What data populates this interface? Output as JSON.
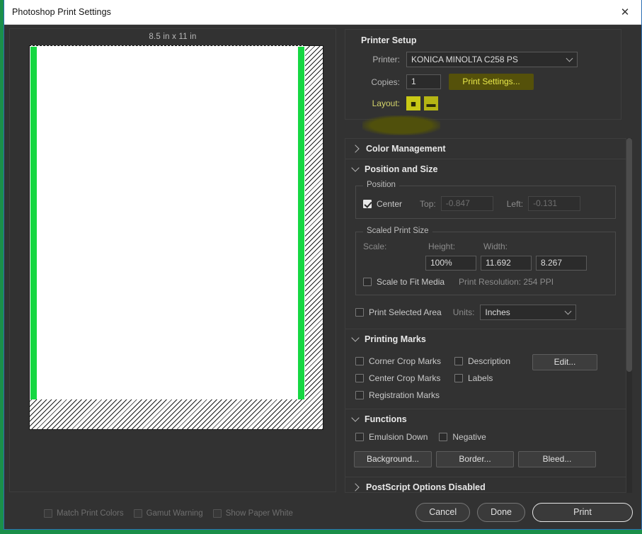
{
  "window": {
    "title": "Photoshop Print Settings",
    "close_icon": "close-icon"
  },
  "preview": {
    "page_dimensions": "8.5 in x 11 in",
    "accent_green": "#16d742",
    "proof_options": [
      {
        "label": "Match Print Colors",
        "checked": false,
        "disabled": true
      },
      {
        "label": "Gamut Warning",
        "checked": false,
        "disabled": true
      },
      {
        "label": "Show Paper White",
        "checked": false,
        "disabled": true
      }
    ]
  },
  "printer_setup": {
    "title": "Printer Setup",
    "printer_label": "Printer:",
    "printer_value": "KONICA MINOLTA C258 PS",
    "copies_label": "Copies:",
    "copies_value": "1",
    "print_settings_button": "Print Settings...",
    "layout_label": "Layout:",
    "layout_portrait_icon": "orientation-portrait-icon",
    "layout_landscape_icon": "orientation-landscape-icon",
    "highlight_color": "#55510a",
    "highlight_text_color": "#e8e84a"
  },
  "sections": {
    "color_management": {
      "title": "Color Management",
      "expanded": false
    },
    "position_and_size": {
      "title": "Position and Size",
      "expanded": true,
      "position_group": "Position",
      "center_label": "Center",
      "center_checked": true,
      "top_label": "Top:",
      "top_value": "-0.847",
      "left_label": "Left:",
      "left_value": "-0.131",
      "scaled_group": "Scaled Print Size",
      "scale_label": "Scale:",
      "scale_value": "100%",
      "height_label": "Height:",
      "height_value": "11.692",
      "width_label": "Width:",
      "width_value": "8.267",
      "scale_to_fit_label": "Scale to Fit Media",
      "scale_to_fit_checked": false,
      "print_resolution": "Print Resolution: 254 PPI",
      "print_selected_area_label": "Print Selected Area",
      "print_selected_area_checked": false,
      "units_label": "Units:",
      "units_value": "Inches"
    },
    "printing_marks": {
      "title": "Printing Marks",
      "expanded": true,
      "col1": [
        {
          "label": "Corner Crop Marks",
          "checked": false
        },
        {
          "label": "Center Crop Marks",
          "checked": false
        },
        {
          "label": "Registration Marks",
          "checked": false
        }
      ],
      "col2": [
        {
          "label": "Description",
          "checked": false
        },
        {
          "label": "Labels",
          "checked": false
        }
      ],
      "edit_button": "Edit..."
    },
    "functions": {
      "title": "Functions",
      "expanded": true,
      "emulsion_down_label": "Emulsion Down",
      "emulsion_down_checked": false,
      "negative_label": "Negative",
      "negative_checked": false,
      "background_button": "Background...",
      "border_button": "Border...",
      "bleed_button": "Bleed..."
    },
    "postscript": {
      "title": "PostScript Options Disabled",
      "expanded": false
    }
  },
  "footer": {
    "cancel_button": "Cancel",
    "done_button": "Done",
    "print_button": "Print"
  }
}
